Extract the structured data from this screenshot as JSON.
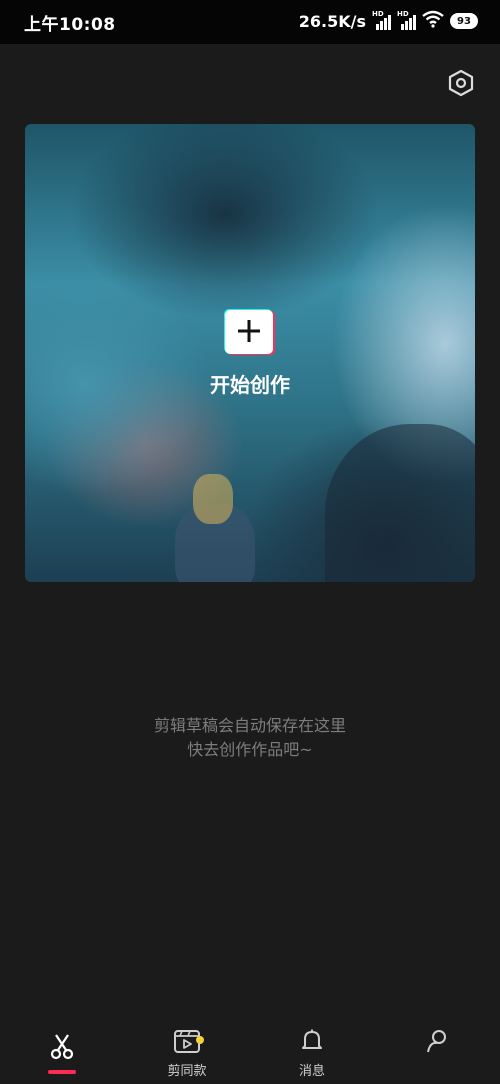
{
  "status_bar": {
    "time": "上午10:08",
    "net_speed": "26.5K/s",
    "network_badge": "HD",
    "battery": "93"
  },
  "hero": {
    "create_label": "开始创作"
  },
  "empty_hint": {
    "line1": "剪辑草稿会自动保存在这里",
    "line2": "快去创作作品吧~"
  },
  "bottom_nav": {
    "templates_label": "剪同款",
    "messages_label": "消息"
  },
  "colors": {
    "accent": "#fe2c55",
    "tiktok_cyan": "#25f4ee",
    "badge": "#f7d13a",
    "background": "#1b1b1b"
  }
}
